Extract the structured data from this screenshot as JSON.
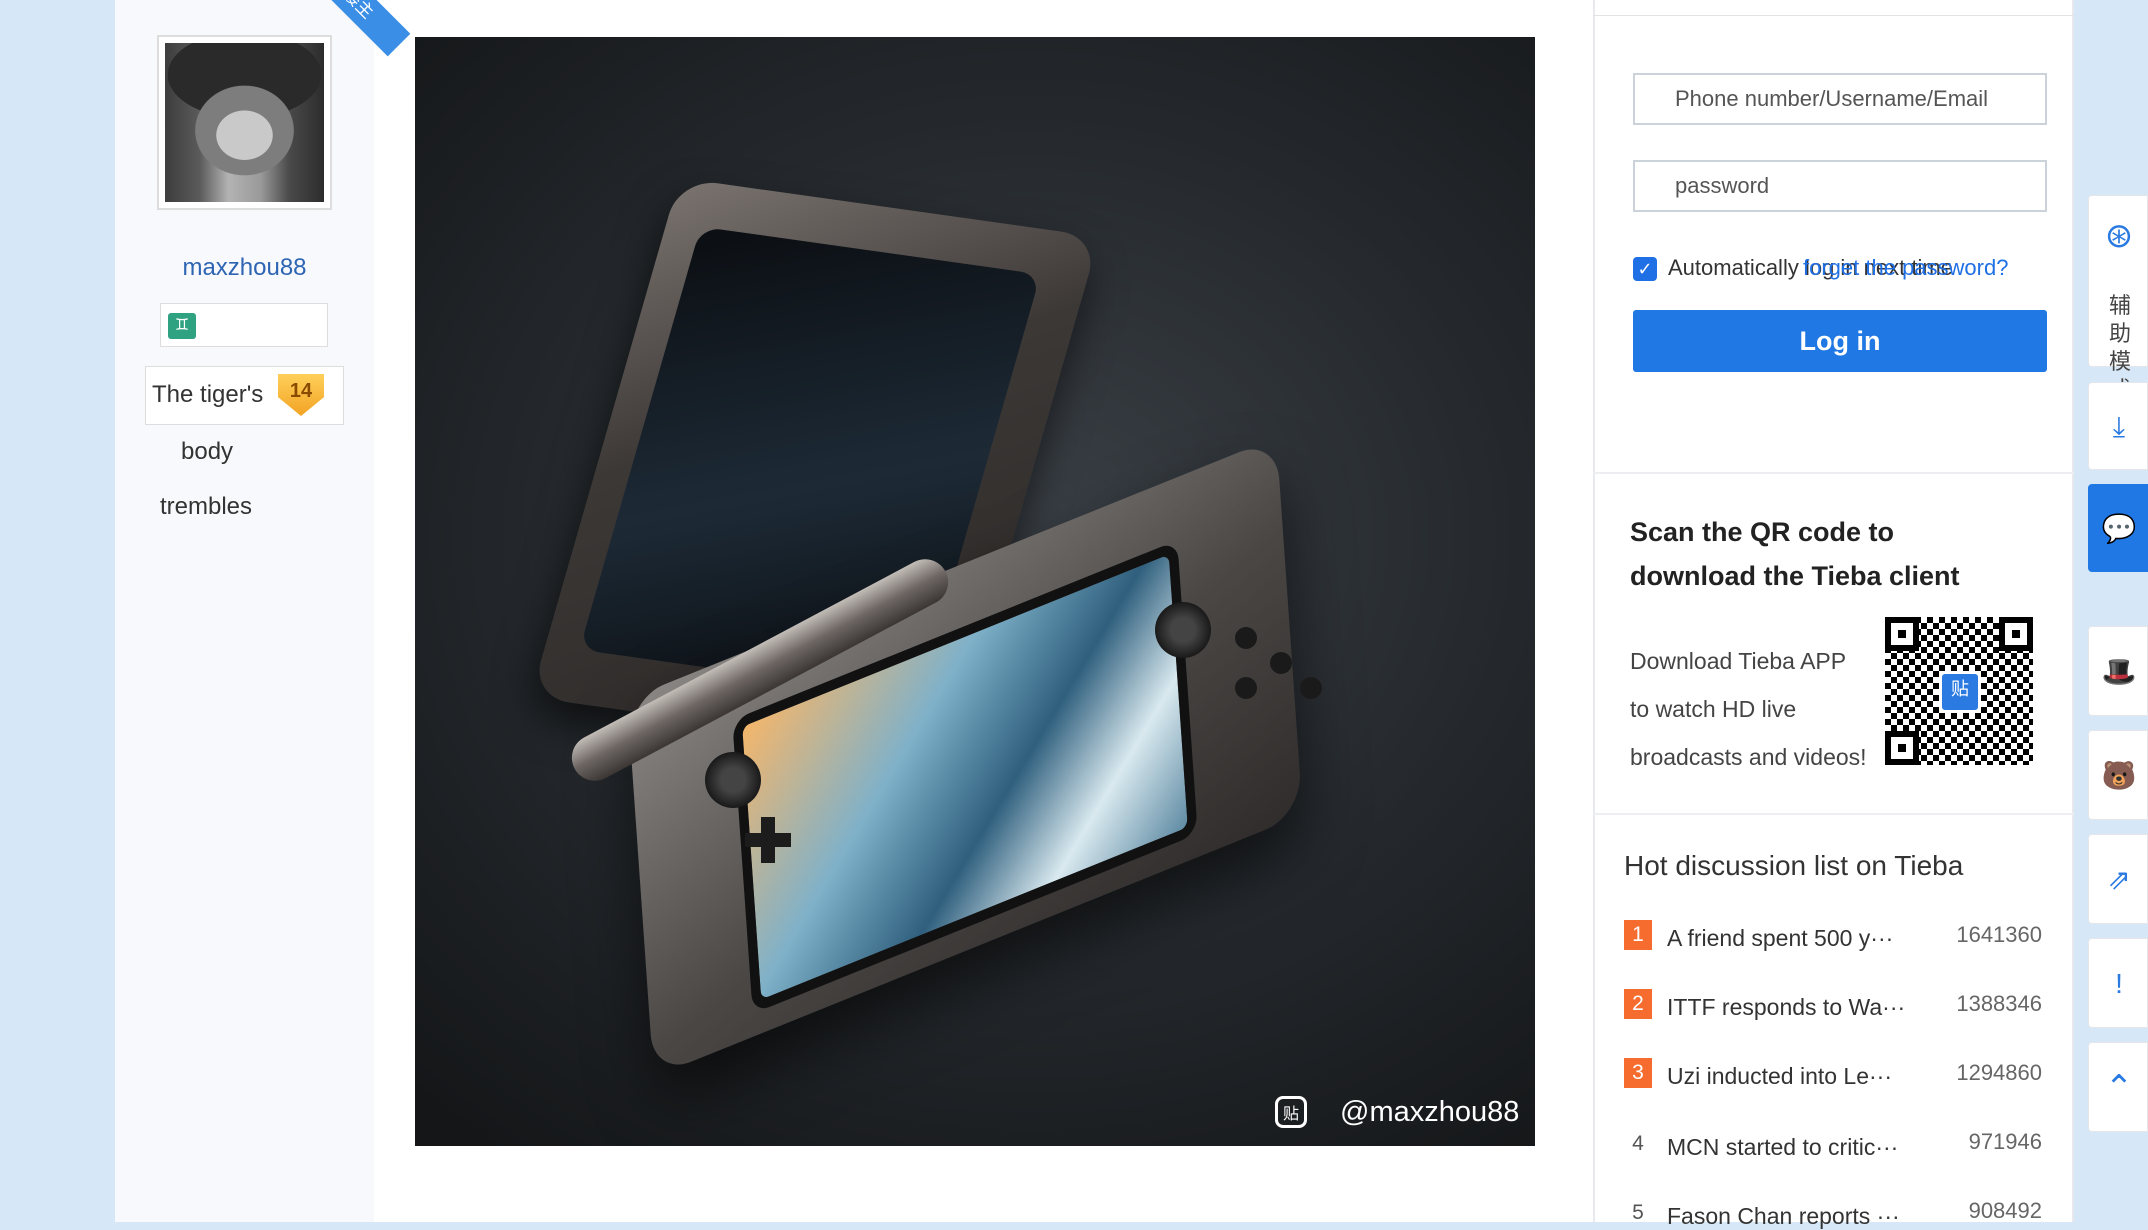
{
  "author": {
    "ribbon_label": "楼主",
    "username": "maxzhou88",
    "badge_glyph": "♊",
    "level_title_line1": "The tiger's",
    "level_title_line2": "body",
    "level_title_line3": "trembles",
    "level_number": "14"
  },
  "post_image": {
    "watermark_icon": "贴",
    "watermark_text": "@maxzhou88"
  },
  "login": {
    "username_placeholder": "Phone number/Username/Email",
    "password_placeholder": "password",
    "remember_checked": true,
    "remember_label": "Automatically log in next time",
    "forgot_label": "forget the password?",
    "login_button": "Log in"
  },
  "qr": {
    "title": "Scan the QR code to download the Tieba client",
    "desc_line1": "Download Tieba APP",
    "desc_line2": "to watch HD live",
    "desc_line3": "broadcasts and videos!",
    "logo_glyph": "贴"
  },
  "hot_list": {
    "title": "Hot discussion list on Tieba",
    "items": [
      {
        "rank": "1",
        "topic": "A friend spent 500 y···",
        "count": "1641360"
      },
      {
        "rank": "2",
        "topic": "ITTF responds to Wa···",
        "count": "1388346"
      },
      {
        "rank": "3",
        "topic": "Uzi inducted into Le···",
        "count": "1294860"
      },
      {
        "rank": "4",
        "topic": "MCN started to critic···",
        "count": "971946"
      },
      {
        "rank": "5",
        "topic": "Fason Chan reports ···",
        "count": "908492"
      }
    ]
  },
  "side_toolbar": {
    "assist_label": "辅助模式",
    "icons": [
      "assist-mode-icon",
      "download-icon",
      "comment-icon",
      "hat-icon",
      "bear-icon",
      "share-icon",
      "report-icon",
      "back-to-top-icon"
    ]
  },
  "colors": {
    "accent_blue": "#1f78e3",
    "link_blue": "#2d64b3",
    "hot_rank_orange": "#f56c2e",
    "page_bg": "#d6e8f7"
  }
}
